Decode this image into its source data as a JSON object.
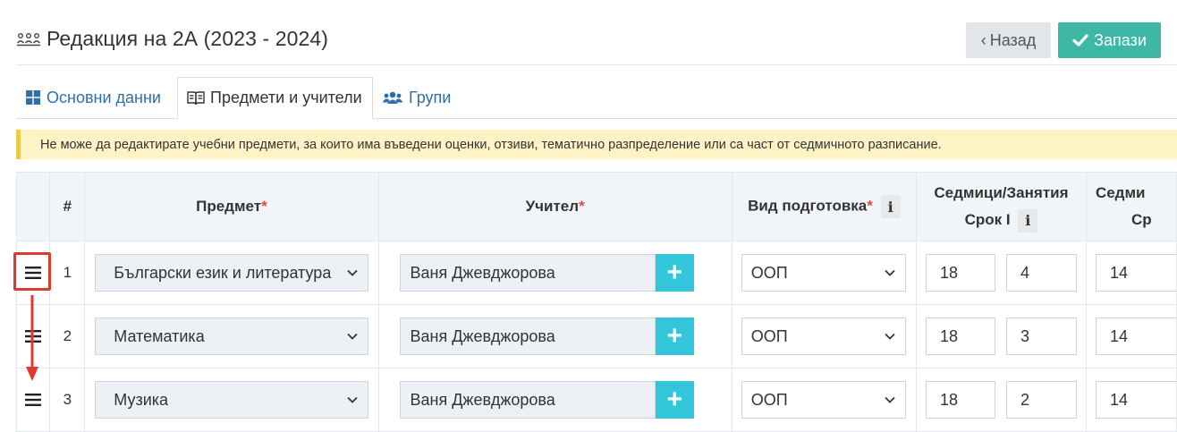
{
  "header": {
    "title": "Редакция на 2А (2023 - 2024)",
    "icon": "classroom-icon"
  },
  "actions": {
    "back_label": "Назад",
    "save_label": "Запази"
  },
  "tabs": [
    {
      "label": "Основни данни",
      "icon": "grid-icon",
      "active": false
    },
    {
      "label": "Предмети и учители",
      "icon": "book-icon",
      "active": true
    },
    {
      "label": "Групи",
      "icon": "users-icon",
      "active": false
    }
  ],
  "alert": {
    "text": "Не може да редактирате учебни предмети, за които има въведени оценки, отзиви, тематично разпределение или са част от седмичното разписание."
  },
  "table": {
    "headers": {
      "num": "#",
      "subject": "Предмет",
      "teacher": "Учител",
      "prep": "Вид подготовка",
      "term1_line1": "Седмици/Занятия",
      "term1_line2": "Срок I",
      "term2_line1": "Седми",
      "term2_line2": "Ср",
      "required_mark": "*",
      "info_glyph": "i"
    },
    "rows": [
      {
        "num": "1",
        "subject": "Български език и литература",
        "teacher": "Ваня Джевджорова",
        "prep": "ООП",
        "weeks1": "18",
        "hours1": "4",
        "weeks2": "14"
      },
      {
        "num": "2",
        "subject": "Математика",
        "teacher": "Ваня Джевджорова",
        "prep": "ООП",
        "weeks1": "18",
        "hours1": "3",
        "weeks2": "14"
      },
      {
        "num": "3",
        "subject": "Музика",
        "teacher": "Ваня Джевджорова",
        "prep": "ООП",
        "weeks1": "18",
        "hours1": "2",
        "weeks2": "14"
      }
    ],
    "add_teacher_glyph": "+"
  },
  "colors": {
    "save": "#3db8a7",
    "back": "#e2e6ea",
    "plus": "#33c5d9",
    "alert_bg": "#fdf3c5",
    "alert_border": "#f0c94a",
    "annotation": "#e03a2f",
    "link": "#2f6fa6"
  }
}
